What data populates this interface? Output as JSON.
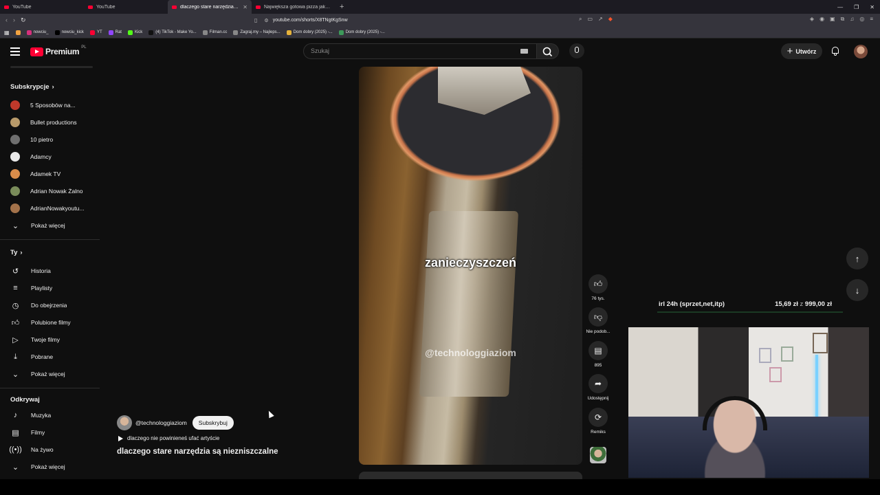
{
  "browser": {
    "tabs": [
      {
        "title": "YouTube",
        "active": false
      },
      {
        "title": "YouTube",
        "active": false
      },
      {
        "title": "dlaczego stare narzędzia są n",
        "active": true
      },
      {
        "title": "Największa gotowa pizza jaką znalazłem",
        "active": false
      }
    ],
    "url": "youtube.com/shorts/X8TNgtKgSnw",
    "bookmarks": [
      "nowciu_",
      "nowciu_kick",
      "YT",
      "Rat",
      "Kick",
      "(4) TikTok - Make Yo...",
      "Filman.cc",
      "Zagraj.my – Najleps...",
      "Dom dobry (2025) -...",
      "Dom dobry (2025) -..."
    ]
  },
  "masthead": {
    "logo_text": "Premium",
    "logo_region": "PL",
    "search_placeholder": "Szukaj",
    "create_label": "Utwórz"
  },
  "sidebar": {
    "subscriptions_heading": "Subskrypcje",
    "subscriptions": [
      {
        "label": "5 Sposobów na...",
        "color": "#c0392b"
      },
      {
        "label": "Bullet productions",
        "color": "#b89a6a"
      },
      {
        "label": "10 pietro",
        "color": "#6f6f6f"
      },
      {
        "label": "Adamcy",
        "color": "#e8e8e8"
      },
      {
        "label": "Adamek TV",
        "color": "#d98c4a"
      },
      {
        "label": "Adrian Nowak Żalno",
        "color": "#7a8c5a"
      },
      {
        "label": "AdrianNowakyoutu...",
        "color": "#a3724a"
      }
    ],
    "show_more_1": "Pokaż więcej",
    "you_heading": "Ty",
    "you_items": [
      {
        "label": "Historia",
        "icon": "history-icon"
      },
      {
        "label": "Playlisty",
        "icon": "playlist-icon"
      },
      {
        "label": "Do obejrzenia",
        "icon": "watch-later-icon"
      },
      {
        "label": "Polubione filmy",
        "icon": "thumbs-up-icon"
      },
      {
        "label": "Twoje filmy",
        "icon": "your-videos-icon"
      },
      {
        "label": "Pobrane",
        "icon": "download-icon"
      }
    ],
    "show_more_2": "Pokaż więcej",
    "explore_heading": "Odkrywaj",
    "explore_items": [
      {
        "label": "Muzyka",
        "icon": "music-icon"
      },
      {
        "label": "Filmy",
        "icon": "movies-icon"
      },
      {
        "label": "Na żywo",
        "icon": "live-icon"
      }
    ],
    "show_more_3": "Pokaż więcej"
  },
  "short": {
    "caption": "zanieczyszczeń",
    "watermark": "@technologgiaziom",
    "channel": "@technologgiaziom",
    "subscribe_label": "Subskrybuj",
    "music": "dlaczego nie powinieneś ufać artyście",
    "title": "dlaczego stare narzędzia są niezniszczalne"
  },
  "actions": {
    "like_count": "76 tys.",
    "dislike_label": "Nie podob...",
    "comments_count": "895",
    "share_label": "Udostępnij",
    "remix_label": "Remiks"
  },
  "stream": {
    "goal_label": "irl 24h (sprzet,net,itp)",
    "goal_current": "15,69 zł",
    "goal_separator": "z",
    "goal_target": "999,00 zł"
  }
}
